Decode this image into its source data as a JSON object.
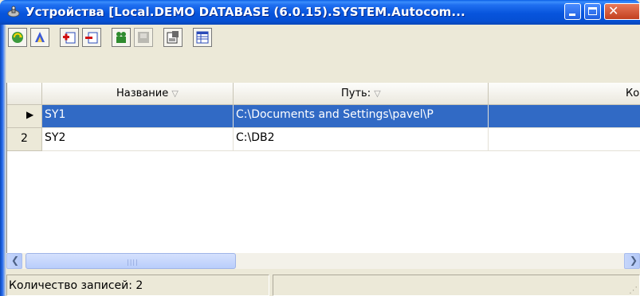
{
  "window": {
    "title": "Устройства [Local.DEMO DATABASE (6.0.15).SYSTEM.Autocom...",
    "icon": "device-satellite-icon"
  },
  "toolbar": {
    "buttons": [
      {
        "name": "refresh-button",
        "icon": "refresh-icon"
      },
      {
        "name": "tool-button",
        "icon": "tool-icon"
      },
      {
        "name": "add-record-button",
        "icon": "add-icon"
      },
      {
        "name": "delete-record-button",
        "icon": "delete-icon"
      },
      {
        "name": "users-button",
        "icon": "users-icon"
      },
      {
        "name": "card-button",
        "icon": "card-icon"
      },
      {
        "name": "properties-button",
        "icon": "properties-icon"
      },
      {
        "name": "columns-button",
        "icon": "table-icon"
      }
    ]
  },
  "grid": {
    "columns": [
      "Название",
      "Путь:",
      "Ко"
    ],
    "sort_glyph": "▽",
    "rows": [
      {
        "indicator": "▶",
        "name": "SY1",
        "path": "C:\\Documents and Settings\\pavel\\P",
        "selected": true
      },
      {
        "indicator": "2",
        "name": "SY2",
        "path": "C:\\DB2",
        "selected": false
      }
    ]
  },
  "status": {
    "record_count": "Количество записей: 2"
  },
  "colors": {
    "titlebar": "#0754dc",
    "selection": "#316ac5",
    "chrome": "#ece9d8"
  }
}
